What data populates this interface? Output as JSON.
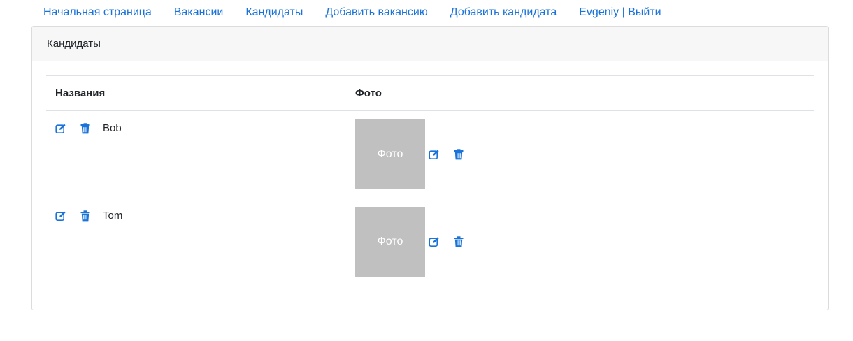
{
  "nav": {
    "home": "Начальная страница",
    "vacancies": "Вакансии",
    "candidates": "Кандидаты",
    "add_vacancy": "Добавить вакансию",
    "add_candidate": "Добавить кандидата",
    "user_logout": "Evgeniy | Выйти"
  },
  "card": {
    "title": "Кандидаты"
  },
  "table": {
    "headers": {
      "name": "Названия",
      "photo": "Фото"
    },
    "rows": [
      {
        "name": "Bob",
        "photo_placeholder": "Фото"
      },
      {
        "name": "Tom",
        "photo_placeholder": "Фото"
      }
    ]
  },
  "colors": {
    "link": "#1a73d8",
    "photo_bg": "#c0c0c0"
  },
  "icons": {
    "edit": "edit-icon",
    "delete": "trash-icon"
  }
}
